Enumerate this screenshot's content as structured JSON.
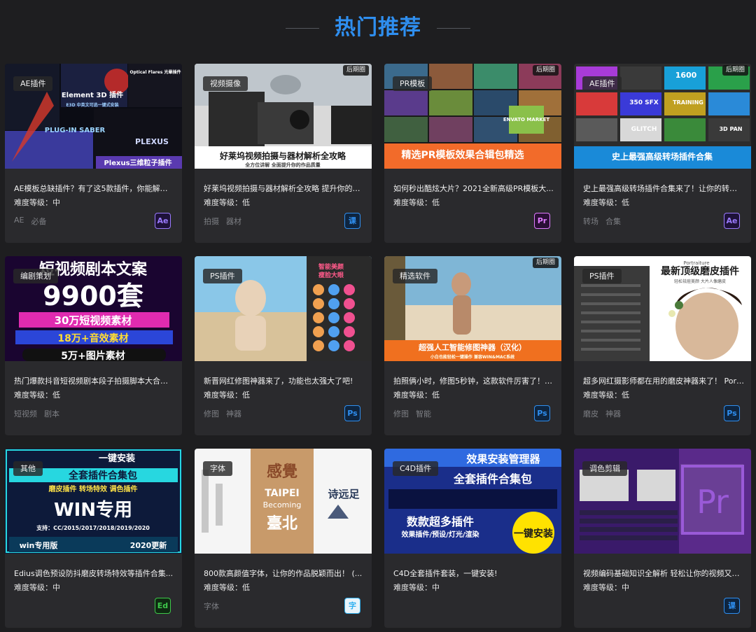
{
  "section": {
    "title": "热门推荐"
  },
  "colors": {
    "accent": "#2f8ff0",
    "background": "#1e1e20",
    "card": "#2a2a2d"
  },
  "difficulty_label": "难度等级：",
  "cards": [
    {
      "category": "AE插件",
      "badge": "",
      "title": "AE模板总缺插件？有了这5款插件，你能解决9...",
      "level": "中",
      "tags": [
        "AE",
        "必备"
      ],
      "software": {
        "label": "Ae",
        "color": "#9b7bff",
        "bg": "#1e123a",
        "icon": "after-effects-icon"
      },
      "thumb": {
        "palette": [
          "#0b0c14",
          "#1b2040",
          "#b42a2a",
          "#3a3a9c",
          "#2d5aa0"
        ],
        "texts": [
          "Element 3D 插件",
          "E3D 中英文可选一键式安装",
          "PLUG-IN SABER",
          "Optical Flares 光晕插件",
          "Plexus三维粒子插件",
          "PLEXUS"
        ]
      }
    },
    {
      "category": "视频摄像",
      "badge": "后期圈",
      "title": "好莱坞视频拍摄与器材解析全攻略 提升你的作...",
      "level": "低",
      "tags": [
        "拍摄",
        "器材"
      ],
      "software": {
        "label": "课",
        "color": "#2f8ff0",
        "bg": "#0e2540",
        "icon": "course-icon"
      },
      "thumb": {
        "palette": [
          "#d9d9d9",
          "#2b2b2b",
          "#6a6a6a",
          "#ffffff"
        ],
        "texts": [
          "好莱坞视频拍摄与器材解析全攻略",
          "全方位讲解 全面提升你的作品质量"
        ]
      }
    },
    {
      "category": "PR模板",
      "badge": "后期圈",
      "title": "如何秒出酷炫大片？2021全新高级PR模板大...",
      "level": "低",
      "tags": [],
      "software": {
        "label": "Pr",
        "color": "#e07bff",
        "bg": "#2a0f35",
        "icon": "premiere-icon"
      },
      "thumb": {
        "palette": [
          "#f26b2a",
          "#2c6a8a",
          "#7a3c2a",
          "#48763a",
          "#a12f4a"
        ],
        "texts": [
          "精选PR模板效果合辑包精选",
          "ENVATO MARKET"
        ]
      }
    },
    {
      "category": "AE插件",
      "badge": "后期圈",
      "title": "史上最强高级转场插件合集来了！让你的转场...",
      "level": "低",
      "tags": [
        "转场",
        "合集"
      ],
      "software": {
        "label": "Ae",
        "color": "#9b7bff",
        "bg": "#1e123a",
        "icon": "after-effects-icon"
      },
      "thumb": {
        "palette": [
          "#1a8ad8",
          "#0d3a6a",
          "#2c2c2c",
          "#a83bd8"
        ],
        "texts": [
          "史上最强高级转场插件合集",
          "1600",
          "350 SFX",
          "TRAINING",
          "GLITCH",
          "3D PAN"
        ]
      }
    },
    {
      "category": "编剧策划",
      "badge": "",
      "title": "热门爆款抖音短视频剧本段子拍摄脚本大合集...",
      "level": "低",
      "tags": [
        "短视频",
        "剧本"
      ],
      "software": null,
      "thumb": {
        "palette": [
          "#3a0a5a",
          "#1a0530",
          "#e02bb0",
          "#ffdd33"
        ],
        "texts": [
          "短视频剧本文案",
          "9900套",
          "30万短视频素材",
          "18万+音效素材",
          "5万+图片素材"
        ]
      }
    },
    {
      "category": "PS插件",
      "badge": "",
      "title": "新晋网红修图神器来了，功能也太强大了吧!",
      "level": "低",
      "tags": [
        "修图",
        "神器"
      ],
      "software": {
        "label": "Ps",
        "color": "#2f8ff0",
        "bg": "#0e2540",
        "icon": "photoshop-icon"
      },
      "thumb": {
        "palette": [
          "#8ac7e8",
          "#e8d2b8",
          "#2a2a2a",
          "#3a6a8a"
        ],
        "texts": [
          "智能美颜",
          "瘦脸大眼"
        ]
      }
    },
    {
      "category": "精选软件",
      "badge": "后期圈",
      "title": "拍照俩小时，修图5秒钟，这款软件厉害了！O...",
      "level": "低",
      "tags": [
        "修图",
        "智能"
      ],
      "software": {
        "label": "Ps",
        "color": "#2f8ff0",
        "bg": "#0e2540",
        "icon": "photoshop-icon"
      },
      "thumb": {
        "palette": [
          "#7fb6d6",
          "#e6d7bd",
          "#3a5a3a",
          "#f0701f"
        ],
        "texts": [
          "超强人工智能修图神器（汉化）",
          "小白也能轻松一键操作 兼容WIN&MAC系统"
        ]
      }
    },
    {
      "category": "PS插件",
      "badge": "",
      "title": "超多网红摄影师都在用的磨皮神器来了！ Port...",
      "level": "低",
      "tags": [
        "磨皮",
        "神器"
      ],
      "software": {
        "label": "Ps",
        "color": "#2f8ff0",
        "bg": "#0e2540",
        "icon": "photoshop-icon"
      },
      "thumb": {
        "palette": [
          "#ffffff",
          "#3a3a3a",
          "#d8b89a",
          "#4a7a3a"
        ],
        "texts": [
          "Portraiture",
          "最新顶级磨皮插件",
          "轻松祛痘美颜 大片人像磨皮"
        ]
      }
    },
    {
      "category": "其他",
      "badge": "",
      "title": "Edius调色预设防抖磨皮转场特效等插件合集...",
      "level": "中",
      "tags": [],
      "software": {
        "label": "Ed",
        "color": "#3ec84a",
        "bg": "#0f2a12",
        "icon": "edius-icon"
      },
      "thumb": {
        "palette": [
          "#0d1a3a",
          "#27d7e0",
          "#ffe347",
          "#ff4fa8"
        ],
        "texts": [
          "一键安装",
          "全套插件合集包",
          "磨皮插件 转场特效 调色插件",
          "WIN专用",
          "支持：CC/2015/2017/2018/2019/2020",
          "win专用版",
          "2020更新"
        ]
      }
    },
    {
      "category": "字体",
      "badge": "",
      "title": "800款高颜值字体，让你的作品脱颖而出！ (...",
      "level": "低",
      "tags": [
        "字体"
      ],
      "software": {
        "label": "字",
        "color": "#2fb0f0",
        "bg": "#e8f4fb",
        "icon": "font-icon"
      },
      "thumb": {
        "palette": [
          "#f5f5f5",
          "#c89a6a",
          "#8a4a2a",
          "#2a3a5a"
        ],
        "texts": [
          "感覺",
          "TAIPEI",
          "Becoming",
          "臺北",
          "诗远足"
        ]
      }
    },
    {
      "category": "C4D插件",
      "badge": "",
      "title": "C4D全套插件套装，一键安装!",
      "level": "中",
      "tags": [],
      "software": null,
      "thumb": {
        "palette": [
          "#1a2e8a",
          "#2f6ae0",
          "#ffe200",
          "#0a1240"
        ],
        "texts": [
          "效果安装管理器",
          "全套插件合集包",
          "数款超多插件",
          "一键安装",
          "效果插件/预设/灯光/渲染"
        ]
      }
    },
    {
      "category": "调色剪辑",
      "badge": "",
      "title": "视频编码基础知识全解析 轻松让你的视频又小...",
      "level": "中",
      "tags": [],
      "software": {
        "label": "课",
        "color": "#2f8ff0",
        "bg": "#0e2540",
        "icon": "course-icon"
      },
      "thumb": {
        "palette": [
          "#5a2a8a",
          "#3a1a6a",
          "#9a5ad8",
          "#2a2a2a"
        ],
        "texts": [
          "Pr"
        ]
      }
    }
  ]
}
